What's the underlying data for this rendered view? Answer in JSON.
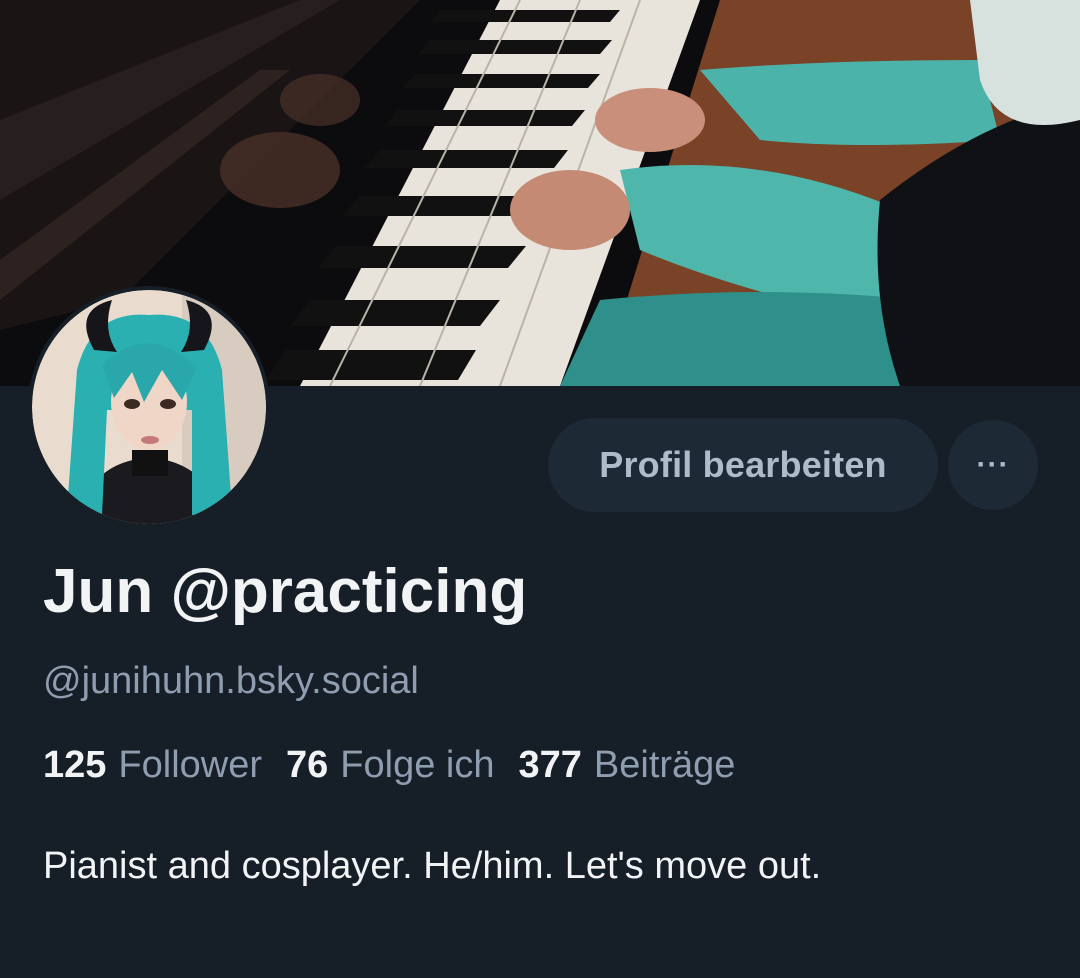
{
  "profile": {
    "display_name": "Jun @practicing",
    "handle": "@junihuhn.bsky.social",
    "edit_button_label": "Profil bearbeiten",
    "more_button_label": "···",
    "stats": {
      "followers_count": "125",
      "followers_label": "Follower",
      "following_count": "76",
      "following_label": "Folge ich",
      "posts_count": "377",
      "posts_label": "Beiträge"
    },
    "bio": "Pianist and cosplayer. He/him. Let's move out."
  },
  "colors": {
    "background": "#161e27",
    "button_bg": "#1e2936",
    "muted_text": "#8f9db0",
    "text": "#f1f3f5",
    "accent_hair": "#2fb5b5"
  }
}
